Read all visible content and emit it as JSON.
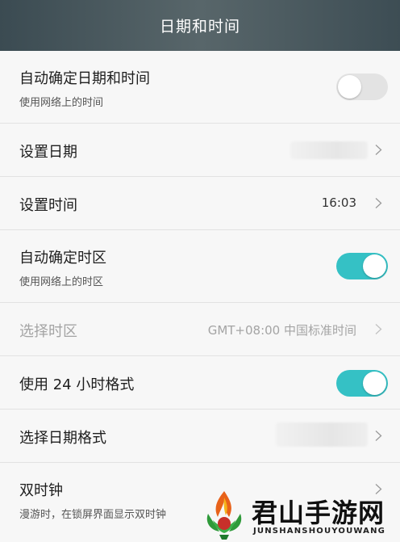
{
  "header": {
    "title": "日期和时间"
  },
  "rows": {
    "auto_datetime": {
      "title": "自动确定日期和时间",
      "subtitle": "使用网络上的时间",
      "toggle": "off"
    },
    "set_date": {
      "title": "设置日期",
      "value": ""
    },
    "set_time": {
      "title": "设置时间",
      "value": "16:03"
    },
    "auto_timezone": {
      "title": "自动确定时区",
      "subtitle": "使用网络上的时区",
      "toggle": "on"
    },
    "select_timezone": {
      "title": "选择时区",
      "value": "GMT+08:00 中国标准时间",
      "enabled": false
    },
    "use_24h": {
      "title": "使用 24 小时格式",
      "toggle": "on"
    },
    "date_format": {
      "title": "选择日期格式",
      "value": ""
    },
    "dual_clock": {
      "title": "双时钟",
      "subtitle": "漫游时，在锁屏界面显示双时钟"
    }
  },
  "watermark": {
    "title": "君山手游网",
    "subtitle": "JUNSHANSHOUYOUWANG"
  },
  "colors": {
    "accent": "#35c1c5",
    "header": "#4a595f"
  },
  "icons": {
    "chevron": "chevron-right-icon"
  }
}
